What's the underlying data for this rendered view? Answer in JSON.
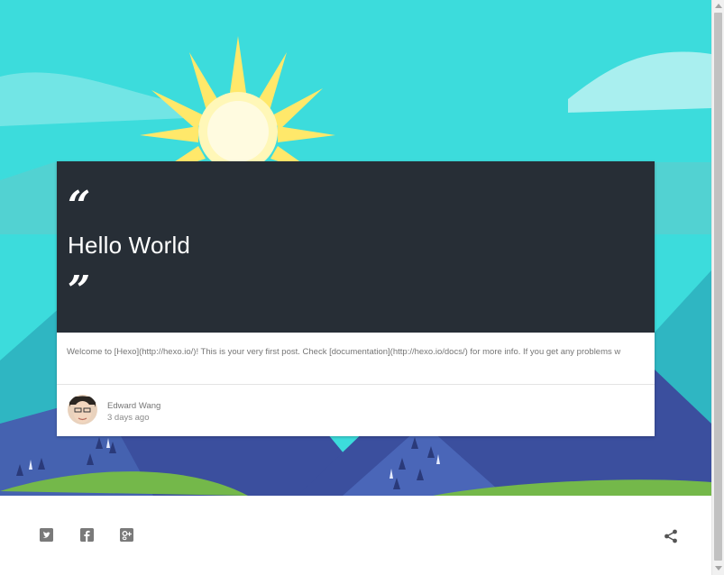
{
  "post": {
    "title": "Hello World",
    "quote_open": "“",
    "quote_close": "”",
    "excerpt": "Welcome to [Hexo](http://hexo.io/)! This is your very first post. Check [documentation](http://hexo.io/docs/) for more info. If you get any problems w",
    "author": "Edward Wang",
    "date": "3 days ago"
  },
  "footer": {
    "social": [
      {
        "name": "twitter",
        "icon": "twitter-icon"
      },
      {
        "name": "facebook",
        "icon": "facebook-icon"
      },
      {
        "name": "google-plus",
        "icon": "google-plus-icon"
      }
    ],
    "share_icon": "share-icon"
  },
  "colors": {
    "sky": "#3cdcdc",
    "card_header": "#272e36",
    "mountain": "#3b4f9e",
    "grass": "#74b84a",
    "sun": "#ffe86a"
  }
}
